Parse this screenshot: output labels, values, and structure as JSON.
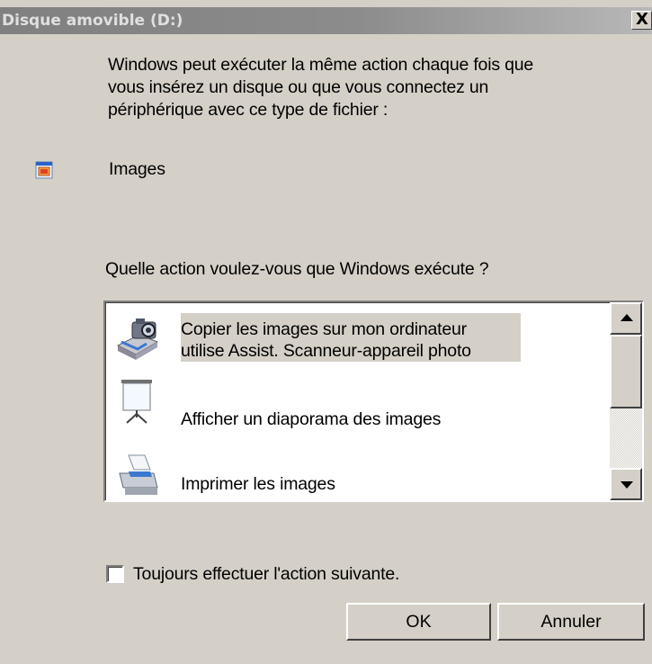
{
  "window": {
    "title": "Disque amovible (D:)",
    "close_label": "X"
  },
  "intro": [
    "Windows peut exécuter la même action chaque fois que",
    "vous insérez un disque ou que vous connectez un",
    "périphérique avec ce type de fichier :"
  ],
  "content_type": {
    "label": "Images",
    "icon": "image-file-icon"
  },
  "question": "Quelle action voulez-vous que Windows exécute ?",
  "actions": [
    {
      "title": "Copier les images sur mon ordinateur",
      "subtitle": "utilise Assist. Scanneur-appareil photo",
      "icon": "camera-copy-icon",
      "selected": true
    },
    {
      "title": "Afficher un diaporama des images",
      "subtitle": "",
      "icon": "slideshow-screen-icon",
      "selected": false
    },
    {
      "title": "Imprimer les images",
      "subtitle": "",
      "icon": "printer-icon",
      "selected": false
    }
  ],
  "always_checkbox": {
    "label": "Toujours effectuer l'action suivante.",
    "checked": false
  },
  "buttons": {
    "ok": "OK",
    "cancel": "Annuler"
  }
}
